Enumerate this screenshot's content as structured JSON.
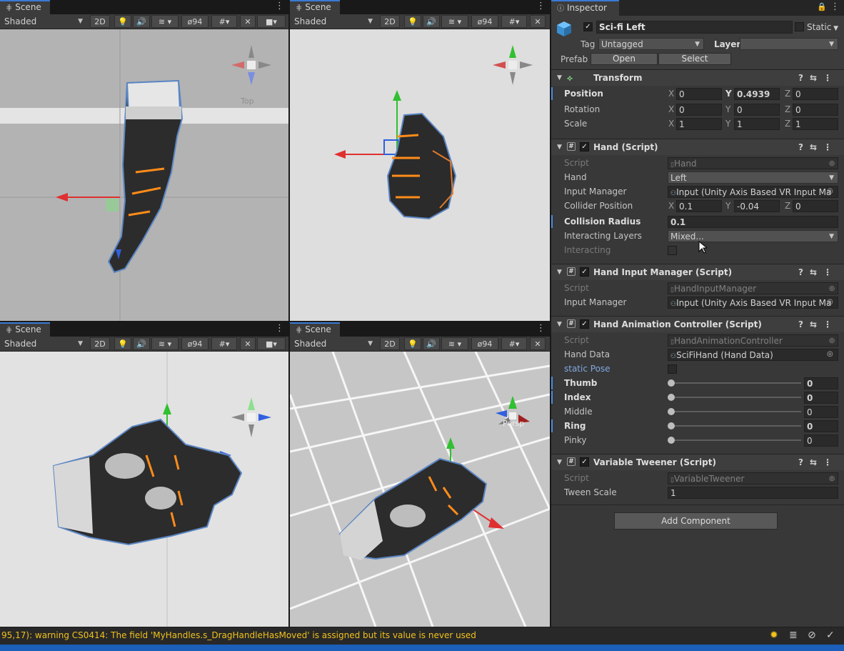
{
  "scene_views": [
    {
      "tab": "Scene",
      "shading": "Shaded",
      "mode_2d": "2D",
      "hidden_count": "94",
      "gizmo_label": "Top"
    },
    {
      "tab": "Scene",
      "shading": "Shaded",
      "mode_2d": "2D",
      "hidden_count": "94",
      "gizmo_label": ""
    },
    {
      "tab": "Scene",
      "shading": "Shaded",
      "mode_2d": "2D",
      "hidden_count": "94",
      "gizmo_label": ""
    },
    {
      "tab": "Scene",
      "shading": "Shaded",
      "mode_2d": "2D",
      "hidden_count": "94",
      "gizmo_label": "Persp"
    }
  ],
  "inspector": {
    "tab": "Inspector",
    "object_name": "Sci-fi Left",
    "static_label": "Static",
    "tag_label": "Tag",
    "tag_value": "Untagged",
    "layer_label": "Layer",
    "layer_value": "",
    "prefab_label": "Prefab",
    "open_label": "Open",
    "select_label": "Select",
    "transform": {
      "title": "Transform",
      "position_label": "Position",
      "rotation_label": "Rotation",
      "scale_label": "Scale",
      "position": {
        "x": "0",
        "y": "0.4939",
        "z": "0"
      },
      "rotation": {
        "x": "0",
        "y": "0",
        "z": "0"
      },
      "scale": {
        "x": "1",
        "y": "1",
        "z": "1"
      }
    },
    "hand": {
      "title": "Hand (Script)",
      "script_label": "Script",
      "script_value": "Hand",
      "hand_label": "Hand",
      "hand_value": "Left",
      "input_manager_label": "Input Manager",
      "input_manager_value": "Input (Unity Axis Based VR Input Ma",
      "collider_label": "Collider Position",
      "collider": {
        "x": "0.1",
        "y": "-0.04",
        "z": "0"
      },
      "radius_label": "Collision Radius",
      "radius_value": "0.1",
      "layers_label": "Interacting Layers",
      "layers_value": "Mixed...",
      "interacting_label": "Interacting"
    },
    "hand_input": {
      "title": "Hand Input Manager (Script)",
      "script_label": "Script",
      "script_value": "HandInputManager",
      "input_manager_label": "Input Manager",
      "input_manager_value": "Input (Unity Axis Based VR Input Ma"
    },
    "hand_anim": {
      "title": "Hand Animation Controller (Script)",
      "script_label": "Script",
      "script_value": "HandAnimationController",
      "hand_data_label": "Hand Data",
      "hand_data_value": "SciFiHand (Hand Data)",
      "static_pose_label": "static Pose",
      "fingers": [
        {
          "label": "Thumb",
          "value": "0",
          "level": 0,
          "bold": true
        },
        {
          "label": "Index",
          "value": "0",
          "level": 0,
          "bold": true
        },
        {
          "label": "Middle",
          "value": "0",
          "level": 0,
          "bold": false
        },
        {
          "label": "Ring",
          "value": "0",
          "level": 0,
          "bold": true
        },
        {
          "label": "Pinky",
          "value": "0",
          "level": 0,
          "bold": false
        }
      ]
    },
    "tweener": {
      "title": "Variable Tweener (Script)",
      "script_label": "Script",
      "script_value": "VariableTweener",
      "scale_label": "Tween Scale",
      "scale_value": "1"
    },
    "add_component": "Add Component"
  },
  "status": {
    "message": "95,17): warning CS0414: The field 'MyHandles.s_DragHandleHasMoved' is assigned but its value is never used"
  }
}
